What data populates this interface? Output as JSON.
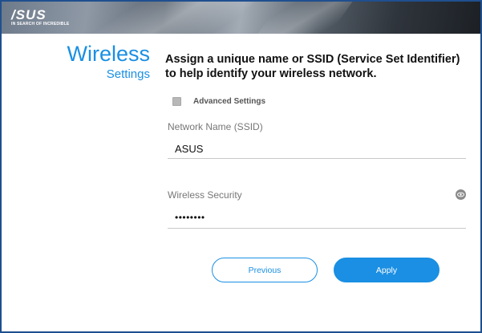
{
  "header": {
    "logo_text": "/SUS",
    "logo_tagline": "IN SEARCH OF INCREDIBLE"
  },
  "sidebar": {
    "title": "Wireless",
    "subtitle": "Settings"
  },
  "main": {
    "heading": "Assign a unique name or SSID (Service Set Identifier) to help identify your wireless network.",
    "advanced_settings": {
      "label": "Advanced Settings",
      "checked": false
    },
    "ssid": {
      "label": "Network Name (SSID)",
      "value": "ASUS"
    },
    "security": {
      "label": "Wireless Security",
      "value": "••••••••",
      "toggle_icon": "eye-icon"
    }
  },
  "buttons": {
    "previous": "Previous",
    "apply": "Apply"
  },
  "colors": {
    "accent": "#1a8fe3",
    "frame_border": "#1f4f8f"
  }
}
